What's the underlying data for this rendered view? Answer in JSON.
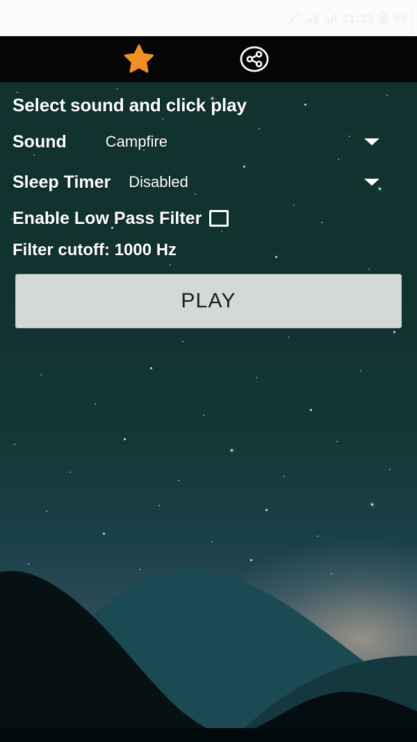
{
  "status_bar": {
    "icons": [
      "microphone-icon",
      "signal-bars-icon",
      "signal-bars-icon"
    ],
    "time": "11:23",
    "battery_level": "58"
  },
  "toolbar": {
    "favorite_icon": "star-icon",
    "share_icon": "share-icon"
  },
  "main": {
    "headline": "Select sound and click play",
    "sound": {
      "label": "Sound",
      "value": "Campfire",
      "caret_icon": "chevron-down-icon"
    },
    "sleep_timer": {
      "label": "Sleep Timer",
      "value": "Disabled",
      "caret_icon": "chevron-down-icon"
    },
    "low_pass_filter": {
      "label": "Enable Low Pass Filter",
      "checked": false
    },
    "filter_cutoff": "Filter cutoff: 1000 Hz",
    "play_label": "PLAY"
  },
  "colors": {
    "accent": "#f09024",
    "toolbar_bg": "#050505",
    "scene_bg": "#0e302c",
    "button_bg": "#d4d9d6",
    "text": "#ffffff"
  }
}
